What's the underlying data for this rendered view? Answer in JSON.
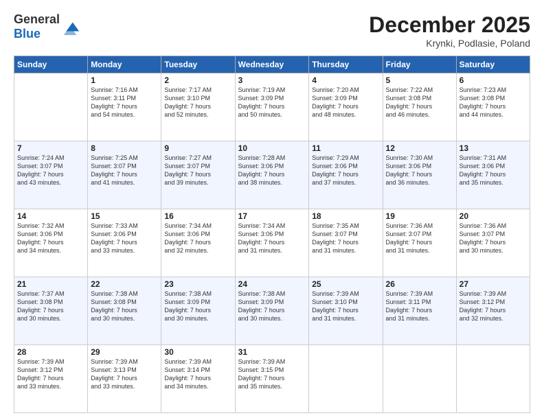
{
  "header": {
    "logo_line1": "General",
    "logo_line2": "Blue",
    "month": "December 2025",
    "location": "Krynki, Podlasie, Poland"
  },
  "days_of_week": [
    "Sunday",
    "Monday",
    "Tuesday",
    "Wednesday",
    "Thursday",
    "Friday",
    "Saturday"
  ],
  "weeks": [
    [
      {
        "day": "",
        "info": ""
      },
      {
        "day": "1",
        "info": "Sunrise: 7:16 AM\nSunset: 3:11 PM\nDaylight: 7 hours\nand 54 minutes."
      },
      {
        "day": "2",
        "info": "Sunrise: 7:17 AM\nSunset: 3:10 PM\nDaylight: 7 hours\nand 52 minutes."
      },
      {
        "day": "3",
        "info": "Sunrise: 7:19 AM\nSunset: 3:09 PM\nDaylight: 7 hours\nand 50 minutes."
      },
      {
        "day": "4",
        "info": "Sunrise: 7:20 AM\nSunset: 3:09 PM\nDaylight: 7 hours\nand 48 minutes."
      },
      {
        "day": "5",
        "info": "Sunrise: 7:22 AM\nSunset: 3:08 PM\nDaylight: 7 hours\nand 46 minutes."
      },
      {
        "day": "6",
        "info": "Sunrise: 7:23 AM\nSunset: 3:08 PM\nDaylight: 7 hours\nand 44 minutes."
      }
    ],
    [
      {
        "day": "7",
        "info": "Sunrise: 7:24 AM\nSunset: 3:07 PM\nDaylight: 7 hours\nand 43 minutes."
      },
      {
        "day": "8",
        "info": "Sunrise: 7:25 AM\nSunset: 3:07 PM\nDaylight: 7 hours\nand 41 minutes."
      },
      {
        "day": "9",
        "info": "Sunrise: 7:27 AM\nSunset: 3:07 PM\nDaylight: 7 hours\nand 39 minutes."
      },
      {
        "day": "10",
        "info": "Sunrise: 7:28 AM\nSunset: 3:06 PM\nDaylight: 7 hours\nand 38 minutes."
      },
      {
        "day": "11",
        "info": "Sunrise: 7:29 AM\nSunset: 3:06 PM\nDaylight: 7 hours\nand 37 minutes."
      },
      {
        "day": "12",
        "info": "Sunrise: 7:30 AM\nSunset: 3:06 PM\nDaylight: 7 hours\nand 36 minutes."
      },
      {
        "day": "13",
        "info": "Sunrise: 7:31 AM\nSunset: 3:06 PM\nDaylight: 7 hours\nand 35 minutes."
      }
    ],
    [
      {
        "day": "14",
        "info": "Sunrise: 7:32 AM\nSunset: 3:06 PM\nDaylight: 7 hours\nand 34 minutes."
      },
      {
        "day": "15",
        "info": "Sunrise: 7:33 AM\nSunset: 3:06 PM\nDaylight: 7 hours\nand 33 minutes."
      },
      {
        "day": "16",
        "info": "Sunrise: 7:34 AM\nSunset: 3:06 PM\nDaylight: 7 hours\nand 32 minutes."
      },
      {
        "day": "17",
        "info": "Sunrise: 7:34 AM\nSunset: 3:06 PM\nDaylight: 7 hours\nand 31 minutes."
      },
      {
        "day": "18",
        "info": "Sunrise: 7:35 AM\nSunset: 3:07 PM\nDaylight: 7 hours\nand 31 minutes."
      },
      {
        "day": "19",
        "info": "Sunrise: 7:36 AM\nSunset: 3:07 PM\nDaylight: 7 hours\nand 31 minutes."
      },
      {
        "day": "20",
        "info": "Sunrise: 7:36 AM\nSunset: 3:07 PM\nDaylight: 7 hours\nand 30 minutes."
      }
    ],
    [
      {
        "day": "21",
        "info": "Sunrise: 7:37 AM\nSunset: 3:08 PM\nDaylight: 7 hours\nand 30 minutes."
      },
      {
        "day": "22",
        "info": "Sunrise: 7:38 AM\nSunset: 3:08 PM\nDaylight: 7 hours\nand 30 minutes."
      },
      {
        "day": "23",
        "info": "Sunrise: 7:38 AM\nSunset: 3:09 PM\nDaylight: 7 hours\nand 30 minutes."
      },
      {
        "day": "24",
        "info": "Sunrise: 7:38 AM\nSunset: 3:09 PM\nDaylight: 7 hours\nand 30 minutes."
      },
      {
        "day": "25",
        "info": "Sunrise: 7:39 AM\nSunset: 3:10 PM\nDaylight: 7 hours\nand 31 minutes."
      },
      {
        "day": "26",
        "info": "Sunrise: 7:39 AM\nSunset: 3:11 PM\nDaylight: 7 hours\nand 31 minutes."
      },
      {
        "day": "27",
        "info": "Sunrise: 7:39 AM\nSunset: 3:12 PM\nDaylight: 7 hours\nand 32 minutes."
      }
    ],
    [
      {
        "day": "28",
        "info": "Sunrise: 7:39 AM\nSunset: 3:12 PM\nDaylight: 7 hours\nand 33 minutes."
      },
      {
        "day": "29",
        "info": "Sunrise: 7:39 AM\nSunset: 3:13 PM\nDaylight: 7 hours\nand 33 minutes."
      },
      {
        "day": "30",
        "info": "Sunrise: 7:39 AM\nSunset: 3:14 PM\nDaylight: 7 hours\nand 34 minutes."
      },
      {
        "day": "31",
        "info": "Sunrise: 7:39 AM\nSunset: 3:15 PM\nDaylight: 7 hours\nand 35 minutes."
      },
      {
        "day": "",
        "info": ""
      },
      {
        "day": "",
        "info": ""
      },
      {
        "day": "",
        "info": ""
      }
    ]
  ]
}
